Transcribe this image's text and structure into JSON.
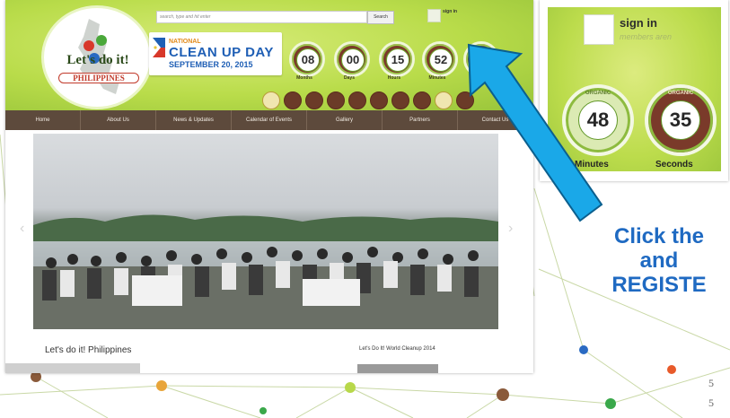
{
  "site": {
    "logo_text": "Let's do it!",
    "logo_sub": "PHILIPPINES",
    "search_placeholder": "search, type and hit enter",
    "search_button": "Search",
    "signin_small": "sign in",
    "banner_line1": "NATIONAL",
    "banner_line2": "CLEAN UP DAY",
    "banner_line3": "SEPTEMBER 20, 2015",
    "countdown": [
      {
        "value": "08",
        "label": "Months"
      },
      {
        "value": "00",
        "label": "Days"
      },
      {
        "value": "15",
        "label": "Hours"
      },
      {
        "value": "52",
        "label": "Minutes"
      }
    ],
    "nav": [
      "Home",
      "About Us",
      "News & Updates",
      "Calendar of Events",
      "Gallery",
      "Partners",
      "Contact Us"
    ],
    "content_title": "Let's do it! Philippines",
    "sidebar_title": "Let's Do It! World Cleanup 2014"
  },
  "zoom": {
    "signin": "sign in",
    "members": "members aren",
    "ring_text": "ORGANIC",
    "badges": [
      {
        "value": "48",
        "label": "Minutes"
      },
      {
        "value": "35",
        "label": "Seconds"
      }
    ]
  },
  "instruction": {
    "line1": "Click the",
    "line2": "and",
    "line3": "REGISTE"
  },
  "page_numbers": [
    "5",
    "5"
  ],
  "colors": {
    "header_green": "#b9dc4a",
    "nav_brown": "#5d4a3c",
    "instruction_blue": "#1f6ac2",
    "arrow_blue": "#1aa8e8"
  }
}
